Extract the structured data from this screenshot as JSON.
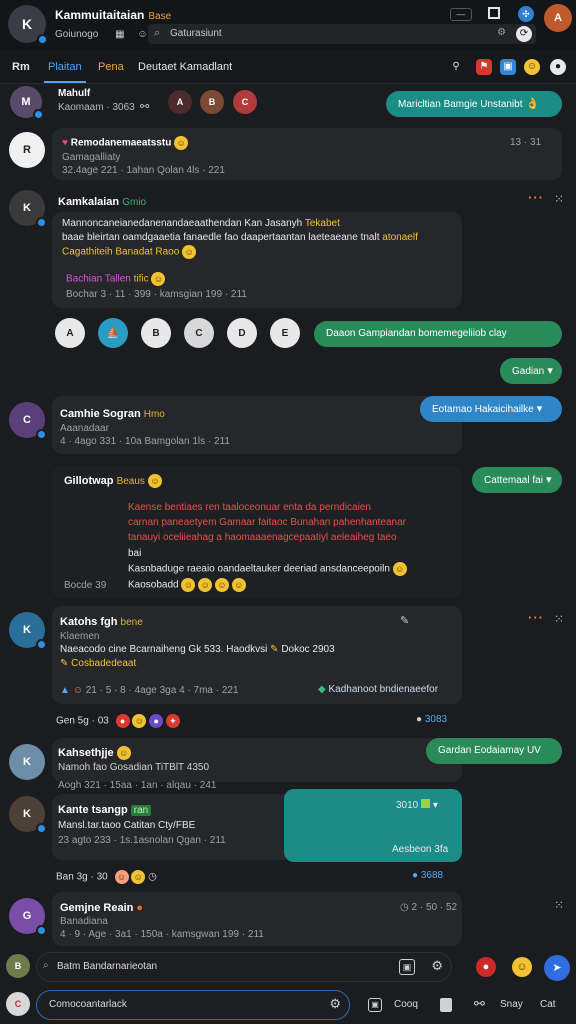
{
  "header": {
    "title": "Kammuitaitaian",
    "title_tag": "Base",
    "subline": "Goiunogo",
    "search_placeholder": "Gaturasiunt",
    "window_controls": [
      "minimize-icon",
      "maximize-icon",
      "close-icon"
    ]
  },
  "tabs": {
    "menu": "Rm",
    "items": [
      "Plaitan",
      "Pena",
      "Deutaet Kamadlant"
    ],
    "active_index": 0,
    "right_icons": [
      "person-add-icon",
      "red-flag-icon",
      "blue-square-icon",
      "smile-icon",
      "circle-icon"
    ]
  },
  "rows": {
    "top_strip": {
      "name": "Mahulf",
      "meta": "Kaomaam · 3063",
      "bubble": "Maricltian Bamgie Unstanibt"
    },
    "card1": {
      "title": "Remodanemaeatsstu",
      "line2": "Gamagalliaty",
      "meta": "32.4age 221 · 1ahan Qolan 4ls · 221",
      "badge": "13 · 31"
    },
    "card2": {
      "name": "Kamkalaian",
      "tag": "Gmio",
      "body1": "Mannoncaneianedanenandaeaathendan Kan Jasanyh",
      "body1_hl": "Tekabet",
      "body2": "baae bleirtan oamdgaaetia fanaedle fao daapertaantan laeteaeane tnalt",
      "body2_hl": "atonaelf",
      "body3": "Cagathiteih Banadat Raoo",
      "body4": "Bachian Tallen",
      "body4_tag": "tific",
      "meta": "Bochar 3 · 11 · 399 · kamsgian 199 · 211"
    },
    "contacts_bubble": "Daaon Gampiandan bomemegeliiob clay",
    "gadian_bubble": "Gadian",
    "card3": {
      "name": "Camhie Sogran",
      "tag": "Hmo",
      "line2": "Aaanadaar",
      "meta": "4 · 4ago 331 · 10a Bamgolan 1ls · 211",
      "bubble": "Eotamao Hakaicihailke"
    },
    "card4": {
      "name": "Gillotwap",
      "tag": "Beaus",
      "bubble": "Cattemaal fai",
      "red1": "Kaense bentiaes ren taaloceonuar enta da perndicaien",
      "red2": "carnan paneaetyem Gamaar faitaoc Bunahan pahenhanteanar",
      "red3": "tanauyi oceliieahag a haomaaaenagcepaatiyl aeleaiheg taeo",
      "line4": "bai",
      "line5": "Kasnbaduge raeaio oandaeltauker deeriad ansdanceepoiln",
      "line6": "Kaosobadd",
      "side_meta": "Bocde 39"
    },
    "card5": {
      "name": "Katohs fgh",
      "tag": "bene",
      "line2": "Klaemen",
      "body": "Naeacodo cine Bcarnaiheng Gk 533. Haodkvsi",
      "body_tag": "Dokoc 2903",
      "body2": "Cosbadedeaat",
      "meta": "21 · 5 · 8 · 4age 3ga 4 · 7ma · 221",
      "link": "Kadhanoot bndienaeefor",
      "row_meta": "Gen 5g · 03",
      "count": "3083"
    },
    "card6": {
      "name": "Kahsethjje",
      "line2": "Namoh fao Gosadian TiTBlT 4350",
      "meta": "Aogh 321 · 15aa · 1an · alqau · 241",
      "bubble": "Gardan Eodaiamay UV"
    },
    "card7": {
      "name": "Kante tsangp",
      "tag": "ran",
      "line2": "Mansl.tar.taoo Catitan Cty/FBE",
      "meta": "23 agto 233 · 1s.1asnolan Qgan · 211",
      "teal_head": "3010",
      "teal_foot": "Aesbeon 3fa",
      "row_meta": "Ban 3g · 30",
      "count": "3688"
    },
    "card8": {
      "name": "Gemjne Reain",
      "line2": "Banadiana",
      "meta": "4 · 9 · Age · 3a1 · 150a · kamsgwan 199 · 211",
      "badge": "2 · 50 · 52"
    }
  },
  "composer": {
    "primary_placeholder": "Batm Bandarnarieotan",
    "secondary_placeholder": "Comocoantarlack",
    "actions": [
      "Cooq",
      "Snay",
      "Cat"
    ]
  },
  "colors": {
    "background": "#1b1c20",
    "card": "#26272b",
    "accent_blue": "#4aa6ff",
    "teal": "#1c8c86",
    "green": "#2a8b5a",
    "orange": "#f0872e",
    "yellow_tag": "#e0b53a"
  }
}
